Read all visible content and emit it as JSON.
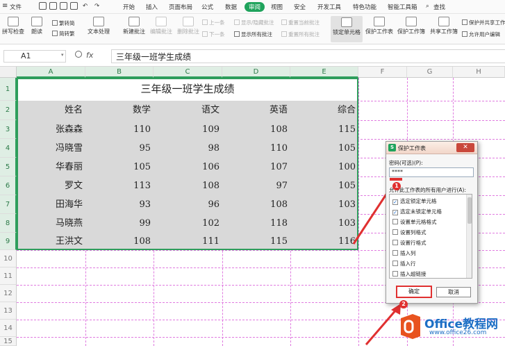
{
  "menubar": {
    "file": "文件",
    "tabs": [
      "开始",
      "插入",
      "页面布局",
      "公式",
      "数据",
      "审阅",
      "视图",
      "安全",
      "开发工具",
      "特色功能",
      "智能工具箱"
    ],
    "active_tab": "审阅",
    "search": "查找"
  },
  "ribbon": {
    "spell_check": "拼写检查",
    "read_aloud": "朗读",
    "to_traditional": "繁转简",
    "to_simplified": "简转繁",
    "text_processing": "文本处理",
    "new_comment": "新建批注",
    "edit_comment": "编辑批注",
    "delete_comment": "删除批注",
    "prev": "上一条",
    "next": "下一条",
    "show_hide_comment": "显示/隐藏批注",
    "show_all_comments": "显示所有批注",
    "reset_current_comment": "重置当前批注",
    "reset_all_comments": "重置所有批注",
    "lock_cells": "锁定单元格",
    "protect_sheet": "保护工作表",
    "protect_workbook": "保护工作簿",
    "share_workbook": "共享工作簿",
    "protect_share_workbook": "保护并共享工作",
    "allow_edit_ranges": "允许用户编辑"
  },
  "formula_bar": {
    "name_box": "A1",
    "fx": "fx",
    "content": "三年级一班学生成绩"
  },
  "grid": {
    "columns": [
      "A",
      "B",
      "C",
      "D",
      "E",
      "F",
      "G",
      "H"
    ],
    "rows": [
      "1",
      "2",
      "3",
      "4",
      "5",
      "6",
      "7",
      "8",
      "9",
      "10",
      "11",
      "12",
      "13",
      "14",
      "15"
    ],
    "title": "三年级一班学生成绩",
    "headers": [
      "姓名",
      "数学",
      "语文",
      "英语",
      "综合"
    ],
    "data": [
      [
        "张森森",
        "110",
        "109",
        "108",
        "115"
      ],
      [
        "冯晓雪",
        "95",
        "98",
        "110",
        "105"
      ],
      [
        "华春丽",
        "105",
        "106",
        "107",
        "100"
      ],
      [
        "罗文",
        "113",
        "108",
        "97",
        "105"
      ],
      [
        "田海华",
        "93",
        "96",
        "108",
        "103"
      ],
      [
        "马晓燕",
        "99",
        "102",
        "118",
        "103"
      ],
      [
        "王洪文",
        "108",
        "111",
        "115",
        "116"
      ]
    ]
  },
  "dialog": {
    "title": "保护工作表",
    "password_label": "密码(可选)(P):",
    "password_value": "****",
    "permissions_label": "允许此工作表的所有用户进行(A):",
    "permissions": [
      {
        "label": "选定锁定单元格",
        "checked": true
      },
      {
        "label": "选定未锁定单元格",
        "checked": true
      },
      {
        "label": "设置单元格格式",
        "checked": false
      },
      {
        "label": "设置列格式",
        "checked": false
      },
      {
        "label": "设置行格式",
        "checked": false
      },
      {
        "label": "插入列",
        "checked": false
      },
      {
        "label": "插入行",
        "checked": false
      },
      {
        "label": "插入超链接",
        "checked": false
      }
    ],
    "ok": "确定",
    "cancel": "取消",
    "close": "✕"
  },
  "annotations": {
    "step1": "1",
    "step2": "2"
  },
  "watermark": {
    "brand": "Office教程网",
    "url": "www.office26.com"
  },
  "colors": {
    "accent": "#2e9e5c",
    "highlight": "#e03030",
    "page_break": "#e07be0",
    "watermark": "#1d6fc5"
  }
}
